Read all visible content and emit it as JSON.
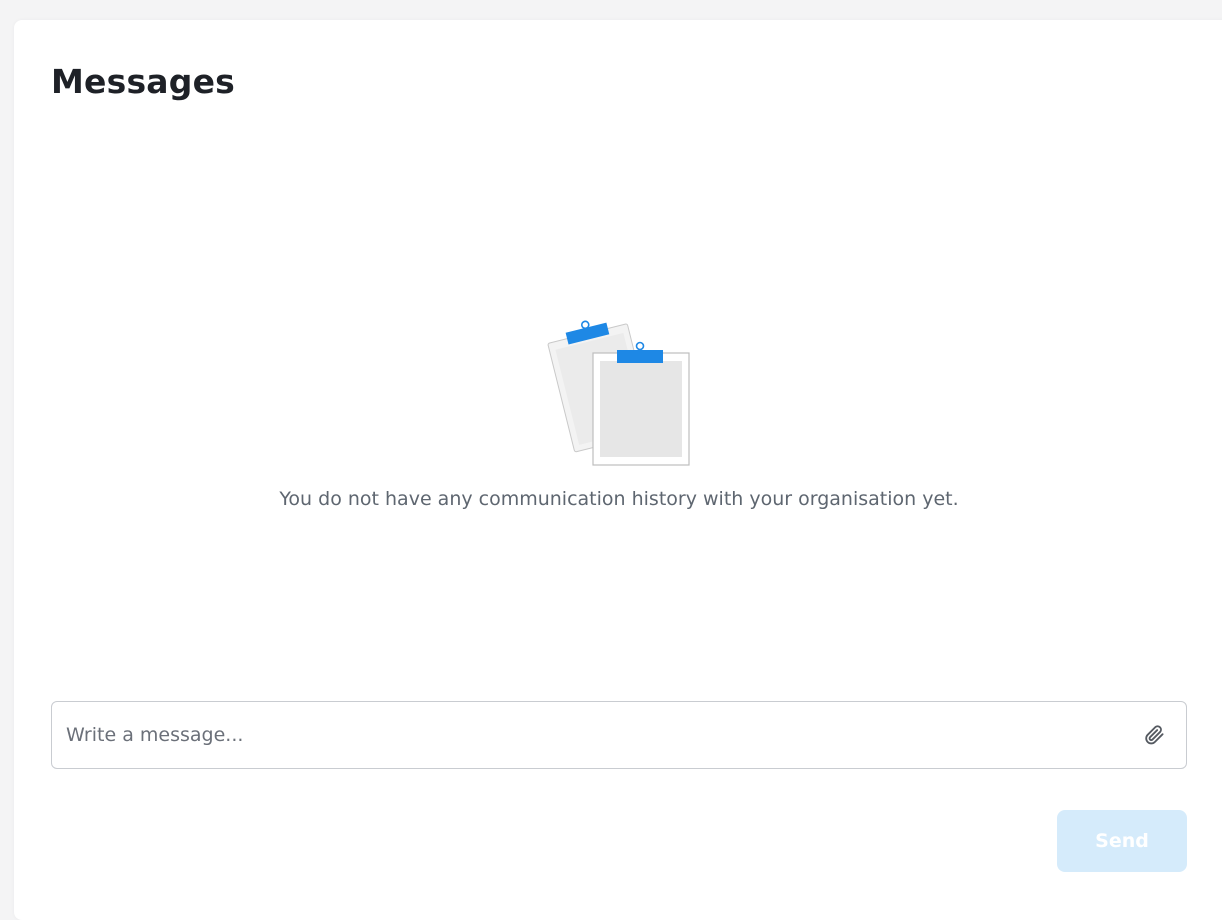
{
  "page": {
    "title": "Messages"
  },
  "empty_state": {
    "icon": "clipboards-icon",
    "message": "You do not have any communication history with your organisation yet."
  },
  "composer": {
    "placeholder": "Write a message...",
    "value": "",
    "attach_icon": "paperclip-icon",
    "send_label": "Send"
  },
  "colors": {
    "accent": "#1e88e5",
    "send_disabled_bg": "#d5ebfb",
    "title": "#1e2127",
    "muted_text": "#5e6670"
  }
}
